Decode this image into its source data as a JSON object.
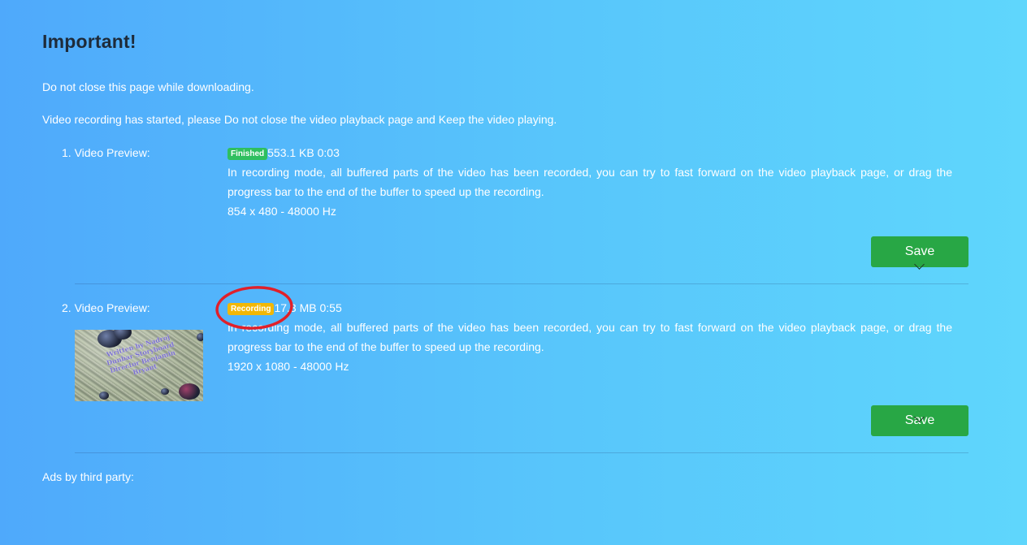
{
  "page": {
    "title": "Important!",
    "notices": [
      "Do not close this page while downloading.",
      "Video recording has started, please Do not close the video playback page and Keep the video playing."
    ],
    "ads_label": "Ads by third party:"
  },
  "videos": [
    {
      "label": "1. Video Preview:",
      "status": "Finished",
      "status_color": "#2fbf5f",
      "size_time": "553.1 KB 0:03",
      "description": "In recording mode, all buffered parts of the video has been recorded, you can try to fast forward on the video playback page, or drag the progress bar to the end of the buffer to speed up the recording.",
      "resolution": "854 x 480 - 48000 Hz",
      "save_label": "Save",
      "has_thumbnail": false
    },
    {
      "label": "2. Video Preview:",
      "status": "Recording",
      "status_color": "#f2b705",
      "size_time": "17.3 MB 0:55",
      "description": "In recording mode, all buffered parts of the video has been recorded, you can try to fast forward on the video playback page, or drag the progress bar to the end of the buffer to speed up the recording.",
      "resolution": "1920 x 1080 - 48000 Hz",
      "save_label": "Save",
      "has_thumbnail": true,
      "thumbnail_caption": "Written by Nadroj Dunbar Storyboard Director Benjamin Bryant"
    }
  ],
  "colors": {
    "save_button": "#28a745",
    "title_text": "#1e2b3a",
    "highlight_circle": "#e0202a"
  }
}
